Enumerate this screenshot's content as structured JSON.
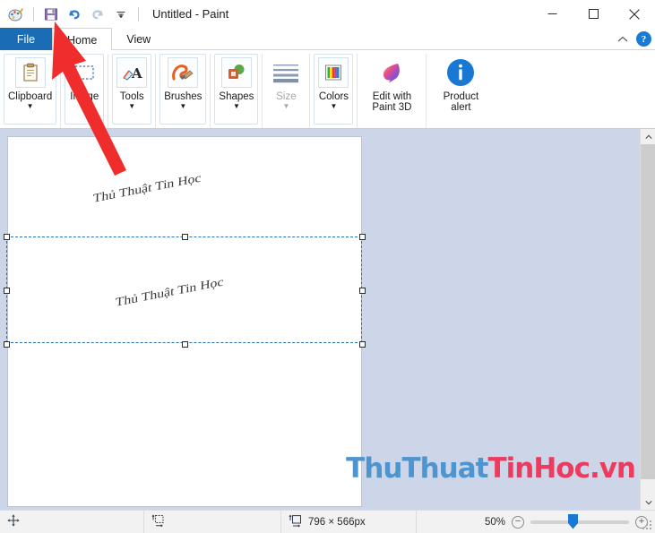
{
  "window": {
    "title": "Untitled - Paint",
    "app_icon": "paint-palette-icon",
    "quick_access": [
      {
        "name": "save-icon",
        "label": "Save"
      },
      {
        "name": "undo-icon",
        "label": "Undo"
      },
      {
        "name": "redo-icon",
        "label": "Redo"
      },
      {
        "name": "customize-qat-icon",
        "label": "Customize Quick Access Toolbar"
      }
    ],
    "controls": {
      "minimize": "Minimize",
      "maximize": "Maximize",
      "close": "Close"
    }
  },
  "tabs": {
    "file": "File",
    "home": "Home",
    "view": "View",
    "collapse_ribbon": "^",
    "help": "?"
  },
  "ribbon": {
    "groups": [
      {
        "label": "Clipboard",
        "icon": "clipboard-icon",
        "caret": true,
        "disabled": false
      },
      {
        "label": "Image",
        "icon": "select-icon",
        "caret": true,
        "disabled": false
      },
      {
        "label": "Tools",
        "icon": "tools-icon",
        "caret": true,
        "disabled": false
      },
      {
        "label": "Brushes",
        "icon": "brush-icon",
        "caret": true,
        "disabled": false
      },
      {
        "label": "Shapes",
        "icon": "shapes-icon",
        "caret": true,
        "disabled": false
      },
      {
        "label": "Size",
        "icon": "size-lines-icon",
        "caret": true,
        "disabled": true
      },
      {
        "label": "Colors",
        "icon": "colors-icon",
        "caret": true,
        "disabled": false
      },
      {
        "label": "Edit with Paint 3D",
        "icon": "paint3d-icon",
        "caret": false,
        "disabled": false
      },
      {
        "label": "Product alert",
        "icon": "info-circle-icon",
        "caret": false,
        "disabled": false
      }
    ]
  },
  "canvas": {
    "text_lines": [
      "Thủ Thuật Tin Học",
      "Thủ Thuật Tin Học"
    ],
    "selection_active": true
  },
  "statusbar": {
    "cursor_icon": "move-cursor-icon",
    "cursor_position": "",
    "selection_icon": "selection-size-icon",
    "selection_size": "",
    "image_icon": "image-size-icon",
    "image_size": "796 × 566px",
    "zoom_level": "50%",
    "zoom_out": "−",
    "zoom_in": "+"
  },
  "watermark": {
    "part1": "ThuThuat",
    "part2": "TinHoc.vn"
  },
  "annotation": {
    "arrow": "red-arrow-pointing-to-file-tab"
  },
  "colors": {
    "file_tab_blue": "#1a6cb5",
    "accent_blue": "#1878d4",
    "workarea": "#ccd6e8",
    "selection_dash": "#2a6fb0",
    "watermark_blue": "#4e94cf",
    "watermark_red": "#ec3b5e",
    "arrow_red": "#ef2d2d"
  }
}
